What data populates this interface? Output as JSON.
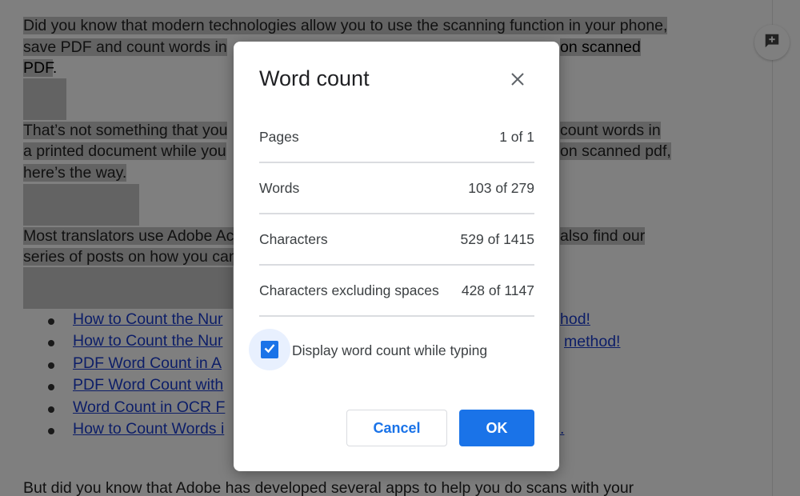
{
  "document": {
    "p1_line1": "Did you know that modern technologies allow you to use the scanning function in your phone,",
    "p1_line2": "save PDF and count words in",
    "p1_line2_end": "on scanned",
    "p1_line3": "PDF",
    "p1_line3_end": ".",
    "p2_line1": "That’s not something that you",
    "p2_line1_end": "count words in",
    "p2_line2": "a printed document while you",
    "p2_line2_end": "on scanned pdf,",
    "p2_line3": "here’s the way.",
    "p3_line1": "Most translators use Adobe Ac",
    "p3_line1_end": "also find our",
    "p3_line2": "series of posts on how you can",
    "links": [
      {
        "left": "How to Count the Nur",
        "right": "hod!"
      },
      {
        "left": "How to Count the Nur",
        "right": "method!"
      },
      {
        "left": "PDF Word Count in A",
        "right": ""
      },
      {
        "left": "PDF Word Count with",
        "right": ""
      },
      {
        "left": "Word Count in OCR F",
        "right": ""
      },
      {
        "left": "How to Count Words i",
        "right": "."
      }
    ],
    "p4_line1": "But did you know that Adobe has developed several apps to help you do scans with your"
  },
  "dialog": {
    "title": "Word count",
    "stats": [
      {
        "label": "Pages",
        "value": "1 of 1"
      },
      {
        "label": "Words",
        "value": "103 of 279"
      },
      {
        "label": "Characters",
        "value": "529 of 1415"
      },
      {
        "label": "Characters excluding spaces",
        "value": "428 of 1147"
      }
    ],
    "checkbox_label": "Display word count while typing",
    "checkbox_checked": true,
    "cancel_label": "Cancel",
    "ok_label": "OK"
  },
  "colors": {
    "accent": "#1a73e8",
    "link": "#1a3dd0",
    "selection": "#c7c7c7"
  },
  "icons": {
    "close": "close-icon",
    "check": "check-icon",
    "add_comment": "add-comment-icon"
  }
}
